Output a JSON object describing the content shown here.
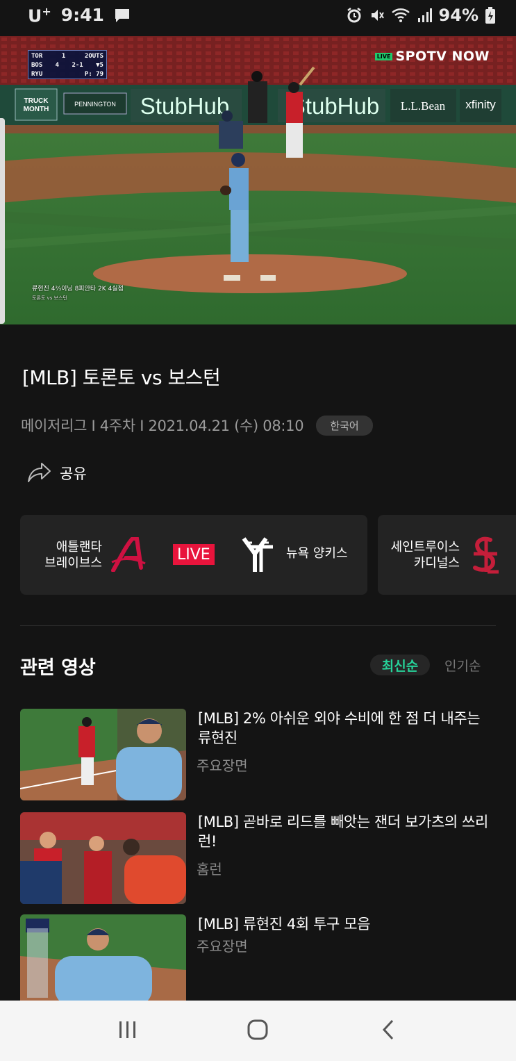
{
  "status_bar": {
    "carrier": "U",
    "carrier_sup": "+",
    "time": "9:41",
    "battery": "94%"
  },
  "video": {
    "scorebug": {
      "team1": "TOR",
      "score1": "1",
      "team2": "BOS",
      "score2": "4",
      "outs": "2OUTS",
      "count": "2-1",
      "inning": "▼5",
      "pitcher": "RYU",
      "pitch_count": "P: 79"
    },
    "broadcaster_live": "LIVE",
    "broadcaster": "SPOTV NOW",
    "caption_line1": "류현진 4⅔이닝 8피안타 2K 4실점",
    "caption_line2": "토론토 vs 보스턴",
    "ads": [
      "FORD TRUCK MONTH",
      "PENNINGTON",
      "StubHub",
      "StubHub",
      "L.L.Bean",
      "xfinity"
    ]
  },
  "program": {
    "title": "[MLB] 토론토 vs 보스턴",
    "meta": "메이저리그 I 4주차 I 2021.04.21 (수) 08:10",
    "language": "한국어"
  },
  "share": {
    "label": "공유"
  },
  "matchups": [
    {
      "home_name_line1": "애틀랜타",
      "home_name_line2": "브레이브스",
      "status": "LIVE",
      "away_name": "뉴욕 양키스"
    },
    {
      "home_name_line1": "세인트루이스",
      "home_name_line2": "카디널스"
    }
  ],
  "related": {
    "title": "관련 영상",
    "sort_latest": "최신순",
    "sort_popular": "인기순",
    "items": [
      {
        "title": "[MLB] 2% 아쉬운 외야 수비에 한 점 더 내주는 류현진",
        "category": "주요장면"
      },
      {
        "title": "[MLB] 곧바로 리드를 빼앗는 잰더 보가츠의 쓰리런!",
        "category": "홈런"
      },
      {
        "title": "[MLB] 류현진 4회 투구 모음",
        "category": "주요장면"
      }
    ]
  },
  "colors": {
    "background": "#141414",
    "accent_green": "#26d39a",
    "live_red": "#e8143c",
    "card_bg": "#232323"
  },
  "icons": [
    "chat-icon",
    "alarm-icon",
    "mute-icon",
    "wifi-icon",
    "signal-icon",
    "battery-icon",
    "share-icon",
    "braves-logo-icon",
    "yankees-logo-icon",
    "cardinals-logo-icon",
    "recents-icon",
    "home-icon",
    "back-icon"
  ]
}
